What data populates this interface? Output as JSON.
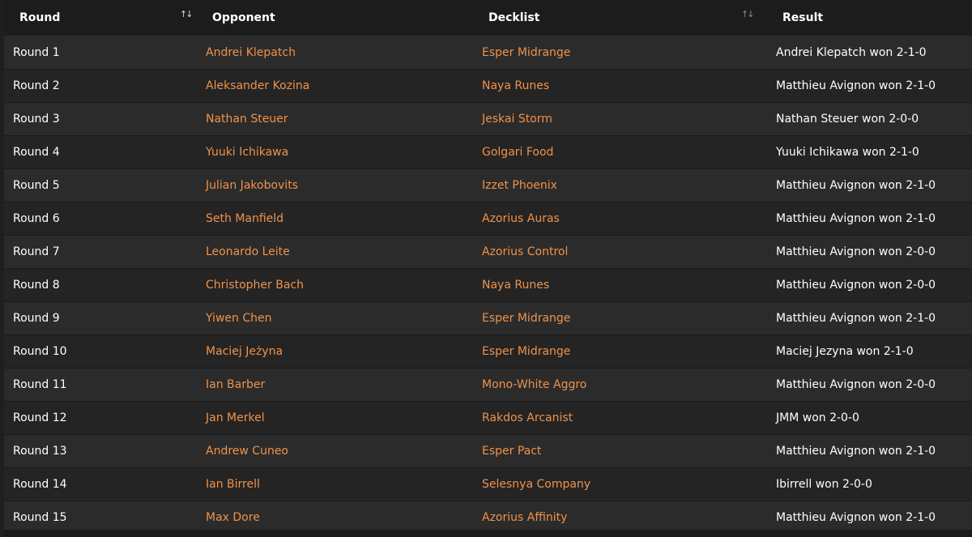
{
  "table": {
    "headers": {
      "round": "Round",
      "opponent": "Opponent",
      "decklist": "Decklist",
      "result": "Result"
    },
    "sort_glyph": "↑↓",
    "rows": [
      {
        "round": "Round 1",
        "opponent": "Andrei Klepatch",
        "decklist": "Esper Midrange",
        "result": "Andrei Klepatch won 2-1-0"
      },
      {
        "round": "Round 2",
        "opponent": "Aleksander Kozina",
        "decklist": "Naya Runes",
        "result": "Matthieu Avignon won 2-1-0"
      },
      {
        "round": "Round 3",
        "opponent": "Nathan Steuer",
        "decklist": "Jeskai Storm",
        "result": "Nathan Steuer won 2-0-0"
      },
      {
        "round": "Round 4",
        "opponent": "Yuuki Ichikawa",
        "decklist": "Golgari Food",
        "result": "Yuuki Ichikawa won 2-1-0"
      },
      {
        "round": "Round 5",
        "opponent": "Julian Jakobovits",
        "decklist": "Izzet Phoenix",
        "result": "Matthieu Avignon won 2-1-0"
      },
      {
        "round": "Round 6",
        "opponent": "Seth Manfield",
        "decklist": "Azorius Auras",
        "result": "Matthieu Avignon won 2-1-0"
      },
      {
        "round": "Round 7",
        "opponent": "Leonardo Leite",
        "decklist": "Azorius Control",
        "result": "Matthieu Avignon won 2-0-0"
      },
      {
        "round": "Round 8",
        "opponent": "Christopher Bach",
        "decklist": "Naya Runes",
        "result": "Matthieu Avignon won 2-0-0"
      },
      {
        "round": "Round 9",
        "opponent": "Yiwen Chen",
        "decklist": "Esper Midrange",
        "result": "Matthieu Avignon won 2-1-0"
      },
      {
        "round": "Round 10",
        "opponent": "Maciej Jeżyna",
        "decklist": "Esper Midrange",
        "result": "Maciej Jezyna won 2-1-0"
      },
      {
        "round": "Round 11",
        "opponent": "Ian Barber",
        "decklist": "Mono-White Aggro",
        "result": "Matthieu Avignon won 2-0-0"
      },
      {
        "round": "Round 12",
        "opponent": "Jan Merkel",
        "decklist": "Rakdos Arcanist",
        "result": "JMM won 2-0-0"
      },
      {
        "round": "Round 13",
        "opponent": "Andrew Cuneo",
        "decklist": "Esper Pact",
        "result": "Matthieu Avignon won 2-1-0"
      },
      {
        "round": "Round 14",
        "opponent": "Ian Birrell",
        "decklist": "Selesnya Company",
        "result": "Ibirrell won 2-0-0"
      },
      {
        "round": "Round 15",
        "opponent": "Max Dore",
        "decklist": "Azorius Affinity",
        "result": "Matthieu Avignon won 2-1-0"
      }
    ]
  },
  "colors": {
    "link": "#f0924a",
    "row_odd": "#2b2b2b",
    "row_even": "#242424",
    "header_bg": "#1c1c1c",
    "text": "#ffffff"
  }
}
